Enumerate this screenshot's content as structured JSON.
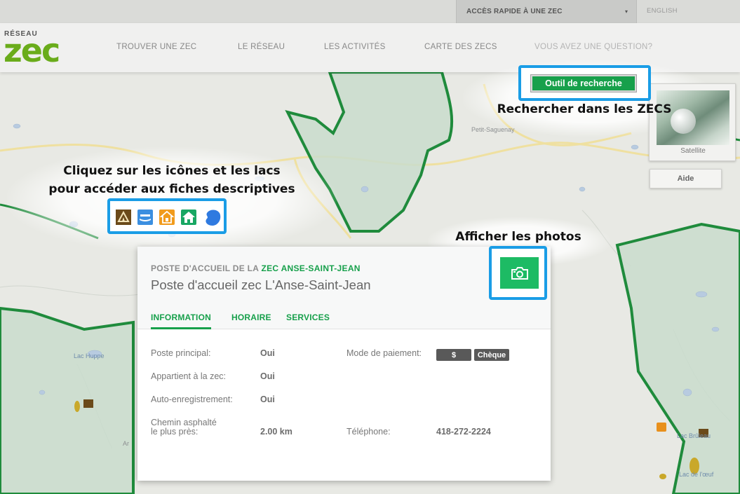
{
  "topbar": {
    "quick_access_label": "ACCÈS RAPIDE À UNE ZEC",
    "quick_access_caret": "▾",
    "language_link": "ENGLISH"
  },
  "logo": {
    "small_text": "RÉSEAU",
    "big_text": "zec"
  },
  "nav": {
    "items": [
      "TROUVER UNE ZEC",
      "LE RÉSEAU",
      "LES ACTIVITÉS",
      "CARTE DES ZECS",
      "VOUS AVEZ UNE QUESTION?"
    ]
  },
  "map": {
    "labels": [
      "Petit-Saguenay",
      "Lac Huppe",
      "Lac Brûleau",
      "Lac de l'œuf",
      "Ar"
    ],
    "satellite_label": "Satellite",
    "help_label": "Aide"
  },
  "annotations": {
    "search_button": "Outil de recherche",
    "search_caption": "Rechercher dans les ZECS",
    "icons_caption_line1": "Cliquez sur les icônes et les lacs",
    "icons_caption_line2": "pour accéder aux fiches descriptives",
    "photos_caption": "Afficher les photos",
    "icons": [
      "camping-icon",
      "boat-launch-icon",
      "chalet-icon",
      "home-icon",
      "lake-icon"
    ]
  },
  "info_panel": {
    "eyebrow_prefix": "POSTE D'ACCUEIL DE LA",
    "eyebrow_zec": "ZEC ANSE-SAINT-JEAN",
    "name": "Poste d'accueil zec L'Anse-Saint-Jean",
    "tabs": [
      "INFORMATION",
      "HORAIRE",
      "SERVICES"
    ],
    "active_tab": "INFORMATION",
    "rows": {
      "main_post_label": "Poste principal:",
      "main_post_value": "Oui",
      "belongs_label": "Appartient à la zec:",
      "belongs_value": "Oui",
      "self_reg_label": "Auto-enregistrement:",
      "self_reg_value": "Oui",
      "road_label_1": "Chemin asphalté",
      "road_label_2": "le plus près:",
      "road_value": "2.00 km",
      "payment_label": "Mode de paiement:",
      "payment_methods": [
        "$",
        "Chèque"
      ],
      "phone_label": "Téléphone:",
      "phone_value": "418-272-2224"
    }
  },
  "colors": {
    "brand_green": "#17a04b",
    "logo_green": "#6aac1b",
    "callout_blue": "#1a9de6",
    "territory_border": "#1f8b3c",
    "territory_fill": "#c9dccd"
  }
}
